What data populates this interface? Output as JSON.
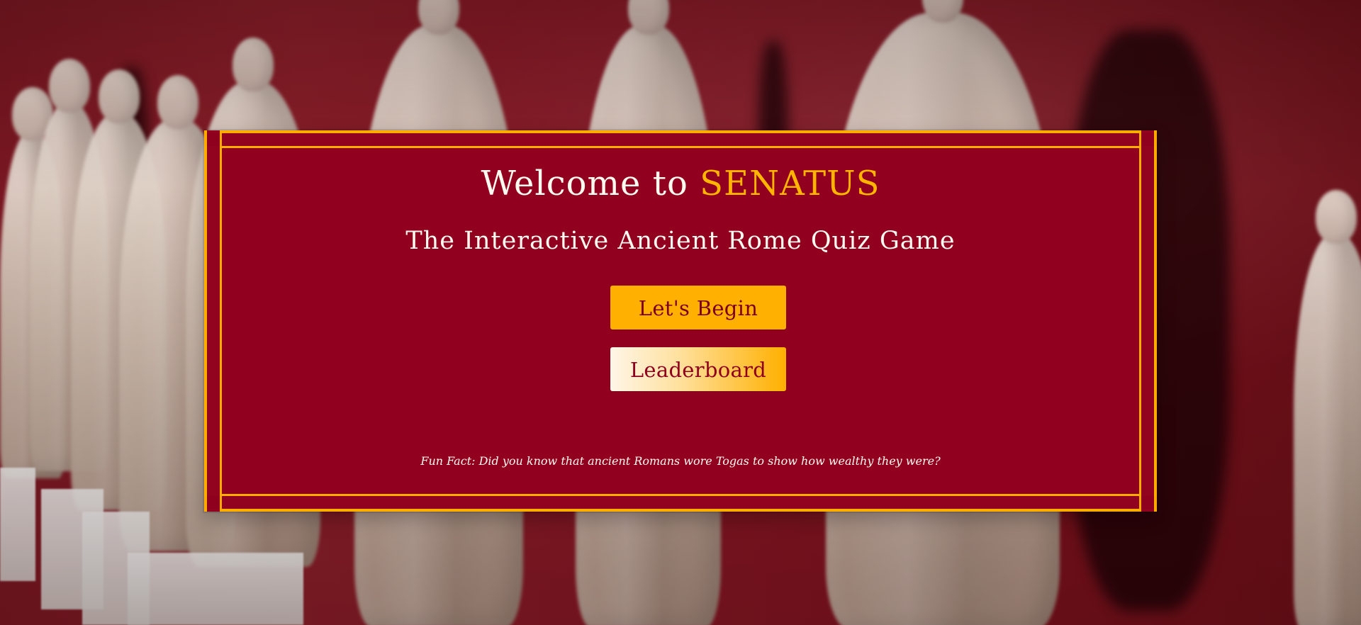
{
  "welcome": {
    "title_prefix": "Welcome to",
    "title_highlight": "SENATUS",
    "subtitle": "The Interactive Ancient Rome Quiz Game"
  },
  "actions": {
    "begin_label": "Let's Begin",
    "leaderboard_label": "Leaderboard"
  },
  "fun_fact": {
    "text": "Fun Fact: Did you know that ancient Romans wore Togas to show how wealthy they were?"
  },
  "colors": {
    "crimson": "#91001f",
    "gold": "#ffb000",
    "cream": "#fffaf0"
  }
}
